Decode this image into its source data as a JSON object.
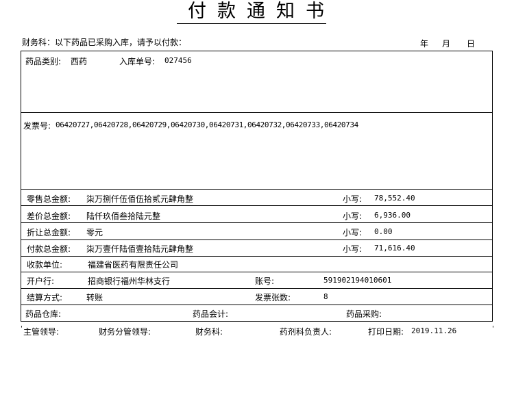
{
  "title": "付款通知书",
  "header": {
    "notice": "财务科：以下药品已采购入库，请予以付款：",
    "year": "年",
    "month": "月",
    "day": "日"
  },
  "info": {
    "category_label": "药品类别:",
    "category_value": "西药",
    "receipt_label": "入库单号:",
    "receipt_value": "027456"
  },
  "invoice": {
    "label": "发票号:",
    "numbers": "06420727,06420728,06420729,06420730,06420731,06420732,06420733,06420734"
  },
  "amounts": [
    {
      "label": "零售总金额:",
      "upper": "柒万捌仟伍佰伍拾贰元肆角整",
      "small_label": "小写:",
      "small_value": "78,552.40"
    },
    {
      "label": "差价总金额:",
      "upper": "陆仟玖佰叁拾陆元整",
      "small_label": "小写:",
      "small_value": "6,936.00"
    },
    {
      "label": "折让总金额:",
      "upper": "零元",
      "small_label": "小写:",
      "small_value": "0.00"
    },
    {
      "label": "付款总金额:",
      "upper": "柒万壹仟陆佰壹拾陆元肆角整",
      "small_label": "小写:",
      "small_value": "71,616.40"
    }
  ],
  "payee": {
    "label": "收款单位:",
    "value": "福建省医药有限责任公司"
  },
  "bank": {
    "label": "开户行:",
    "value": "招商银行福州华林支行",
    "account_label": "账号:",
    "account_value": "591902194010601"
  },
  "settlement": {
    "label": "结算方式:",
    "value": "转账",
    "count_label": "发票张数:",
    "count_value": "8"
  },
  "departments": {
    "warehouse": "药品仓库:",
    "accounting": "药品会计:",
    "purchasing": "药品采购:"
  },
  "footer": {
    "prefix_mark": "'",
    "leader": "主管领导:",
    "finance_leader": "财务分管领导:",
    "finance_dept": "财务科:",
    "pharmacy_head": "药剂科负责人:",
    "print_date_label": "打印日期:",
    "print_date_value": "2019.11.26",
    "suffix_mark": "'"
  }
}
